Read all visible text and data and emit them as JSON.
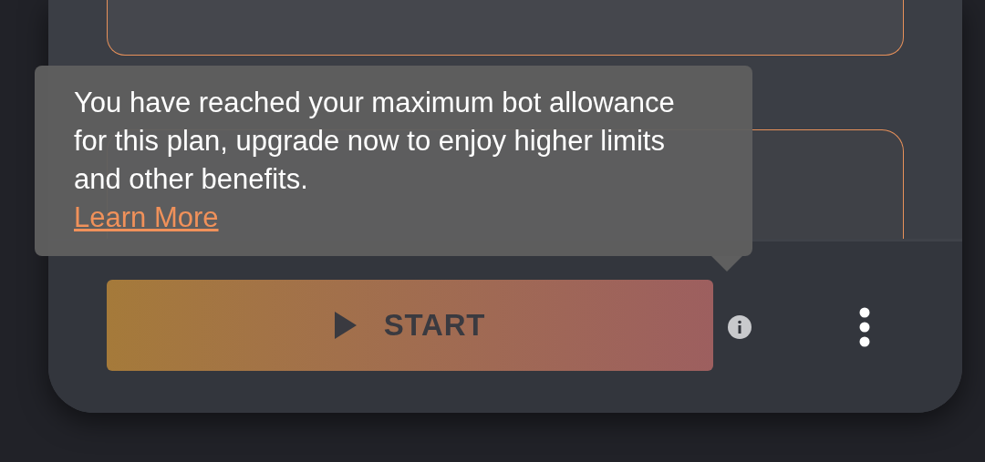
{
  "tooltip": {
    "text": "You have reached your maximum bot allowance for this plan, upgrade now to enjoy higher limits and other benefits.",
    "link": "Learn More"
  },
  "start_button": {
    "label": "START"
  }
}
